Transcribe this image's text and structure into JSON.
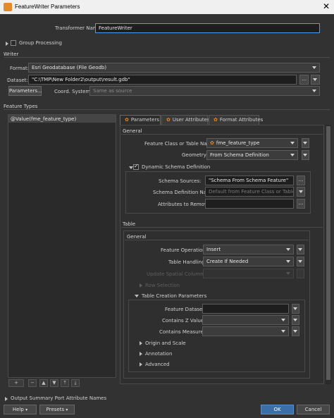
{
  "window": {
    "title": "FeatureWriter Parameters",
    "close": "✕"
  },
  "transformer": {
    "label": "Transformer Name:",
    "value": "FeatureWriter"
  },
  "group_processing": {
    "label": "Group Processing"
  },
  "writer": {
    "section": "Writer",
    "format_label": "Format:",
    "format_value": "Esri Geodatabase (File Geodb)",
    "dataset_label": "Dataset:",
    "dataset_value": "\"C:\\TMP\\New Folder2\\output\\result.gdb\"",
    "parameters_button": "Parameters...",
    "coord_label": "Coord. System:",
    "coord_value": "Same as source"
  },
  "feature_types": {
    "section": "Feature Types",
    "list": [
      "@Value(fme_feature_type)"
    ]
  },
  "tabs": [
    "Parameters",
    "User Attributes",
    "Format Attributes"
  ],
  "general": {
    "section": "General",
    "fc_label": "Feature Class or Table Name:",
    "fc_value": "fme_feature_type",
    "geometry_label": "Geometry:",
    "geometry_value": "From Schema Definition",
    "dynamic_schema": "Dynamic Schema Definition",
    "schema_sources_label": "Schema Sources:",
    "schema_sources_value": "\"Schema From Schema Feature\"",
    "schema_def_label": "Schema Definition Name:",
    "schema_def_placeholder": "Default from Feature Class or Table nam...",
    "attrs_remove_label": "Attributes to Remove:"
  },
  "table": {
    "section": "Table",
    "general": "General",
    "feature_op_label": "Feature Operation:",
    "feature_op_value": "Insert",
    "table_handling_label": "Table Handling:",
    "table_handling_value": "Create If Needed",
    "update_spatial_label": "Update Spatial Column(s):",
    "row_selection": "Row Selection",
    "creation_params": "Table Creation Parameters",
    "feature_dataset_label": "Feature Dataset:",
    "contains_z_label": "Contains Z Values:",
    "contains_m_label": "Contains Measures:",
    "origin_scale": "Origin and Scale",
    "annotation": "Annotation",
    "advanced": "Advanced"
  },
  "toolbar": {
    "add": "+",
    "remove": "−",
    "up": "▲",
    "down": "▼",
    "top": "⤒",
    "bottom": "⤓"
  },
  "summary": {
    "label": "Output Summary Port Attribute Names"
  },
  "footer": {
    "help": "Help",
    "presets": "Presets",
    "ok": "OK",
    "cancel": "Cancel"
  },
  "colors": {
    "accent": "#3b6fa8",
    "focus": "#4e9ee6",
    "gear": "#e08b2a"
  }
}
